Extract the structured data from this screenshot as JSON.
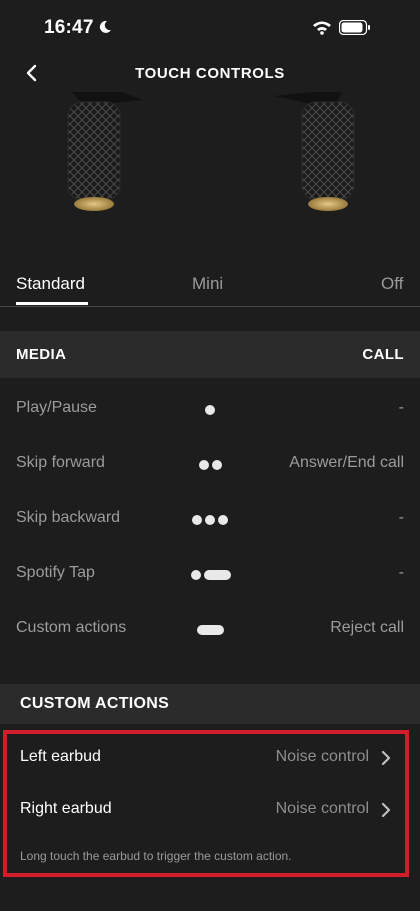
{
  "status_bar": {
    "time": "16:47"
  },
  "nav": {
    "title": "TOUCH CONTROLS"
  },
  "tabs": [
    {
      "label": "Standard",
      "active": true
    },
    {
      "label": "Mini",
      "active": false
    },
    {
      "label": "Off",
      "active": false
    }
  ],
  "media_section": {
    "header_left": "MEDIA",
    "header_right": "CALL",
    "rows": [
      {
        "label": "Play/Pause",
        "gesture": "single-tap",
        "call": "-"
      },
      {
        "label": "Skip forward",
        "gesture": "double-tap",
        "call": "Answer/End call"
      },
      {
        "label": "Skip backward",
        "gesture": "triple-tap",
        "call": "-"
      },
      {
        "label": "Spotify Tap",
        "gesture": "tap-and-hold",
        "call": "-"
      },
      {
        "label": "Custom actions",
        "gesture": "long-press",
        "call": "Reject call"
      }
    ]
  },
  "custom_actions": {
    "title": "CUSTOM ACTIONS",
    "items": [
      {
        "label": "Left earbud",
        "value": "Noise control"
      },
      {
        "label": "Right earbud",
        "value": "Noise control"
      }
    ],
    "note": "Long touch the earbud to trigger the custom action."
  },
  "colors": {
    "background": "#1d1d1d",
    "section_bg": "#2b2b2b",
    "highlight_border": "#d21e2b"
  }
}
